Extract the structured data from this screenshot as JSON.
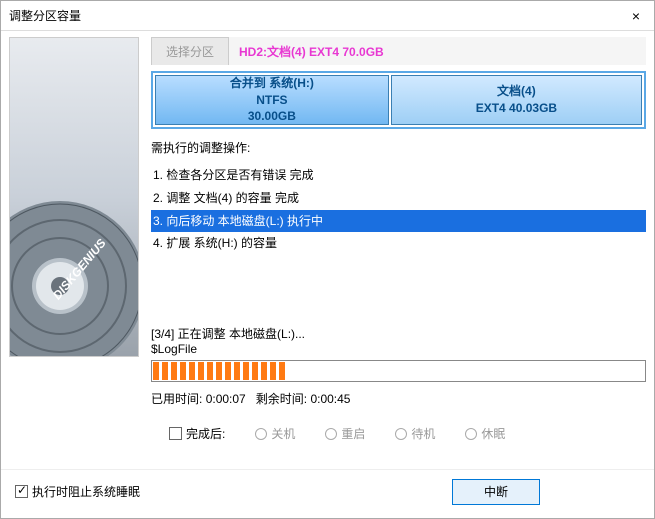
{
  "window": {
    "title": "调整分区容量"
  },
  "tabs": {
    "select": "选择分区",
    "info": "HD2:文档(4) EXT4 70.0GB"
  },
  "partitions": [
    {
      "l1": "合并到 系统(H:)",
      "l2": "NTFS",
      "l3": "30.00GB"
    },
    {
      "l1": "文档(4)",
      "l2": "EXT4 40.03GB"
    }
  ],
  "ops": {
    "header": "需执行的调整操作:",
    "items": [
      "1. 检查各分区是否有错误    完成",
      "2. 调整 文档(4) 的容量    完成",
      "3. 向后移动 本地磁盘(L:)    执行中",
      "4. 扩展 系统(H:) 的容量"
    ]
  },
  "status": {
    "line1": "[3/4] 正在调整 本地磁盘(L:)...",
    "line2": "$LogFile"
  },
  "time": {
    "elapsed_label": "已用时间:",
    "elapsed": "0:00:07",
    "remain_label": "剩余时间:",
    "remain": "0:00:45"
  },
  "after": {
    "cb": "完成后:",
    "r1": "关机",
    "r2": "重启",
    "r3": "待机",
    "r4": "休眠"
  },
  "footer": {
    "prevent": "执行时阻止系统睡眠",
    "abort": "中断"
  },
  "brand": "DISKGENIUS"
}
